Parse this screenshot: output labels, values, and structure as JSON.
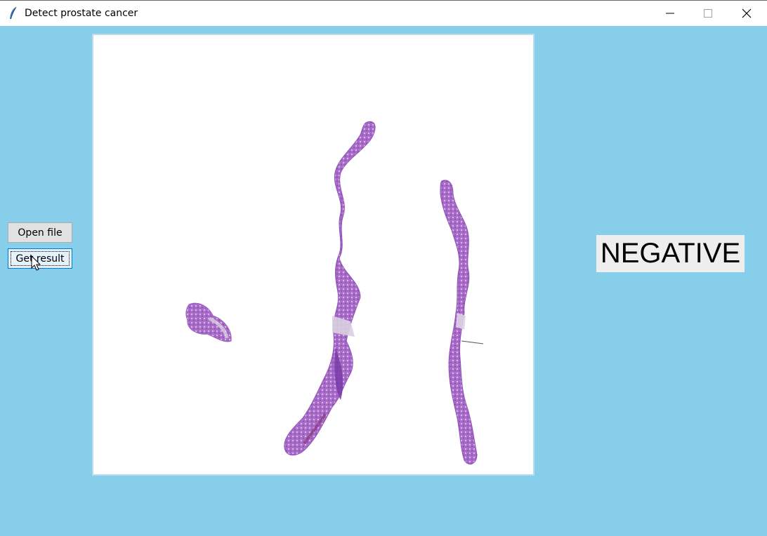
{
  "window": {
    "title": "Detect prostate cancer",
    "controls": [
      "minimize-icon",
      "maximize-icon",
      "close-icon"
    ]
  },
  "buttons": {
    "open_file": "Open file",
    "get_result": "Get result"
  },
  "result": {
    "label": "NEGATIVE"
  },
  "image_panel": {
    "content": "histology slide with tissue cores"
  },
  "colors": {
    "window_background": "#87ceeb",
    "tissue": "#a66bc4",
    "tissue_dark": "#7a3fa6"
  }
}
